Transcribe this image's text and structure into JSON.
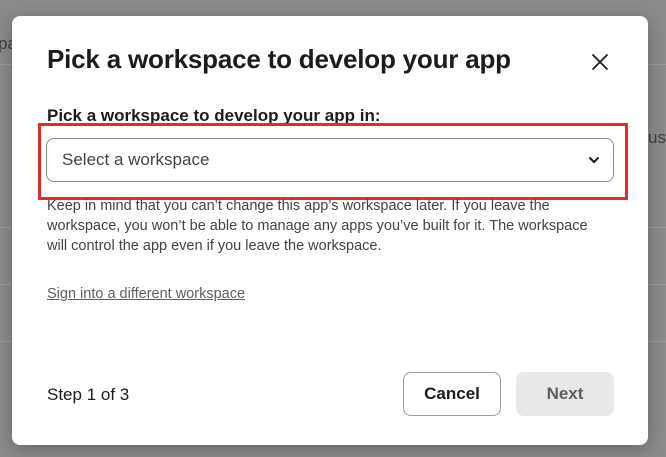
{
  "background": {
    "fragment_left": "pa",
    "fragment_right": "us"
  },
  "modal": {
    "title": "Pick a workspace to develop your app",
    "close_icon": "close-icon",
    "field_label": "Pick a workspace to develop your app in:",
    "select": {
      "value": "Select a workspace",
      "icon": "chevron-down-icon"
    },
    "help_text": "Keep in mind that you can’t change this app’s workspace later. If you leave the workspace, you won’t be able to manage any apps you’ve built for it. The workspace will control the app even if you leave the workspace.",
    "link_text": "Sign into a different workspace",
    "footer": {
      "step_text": "Step 1 of 3",
      "cancel_label": "Cancel",
      "next_label": "Next"
    }
  },
  "colors": {
    "highlight": "#e42b2b",
    "next_disabled_bg": "#e8e8e8"
  }
}
